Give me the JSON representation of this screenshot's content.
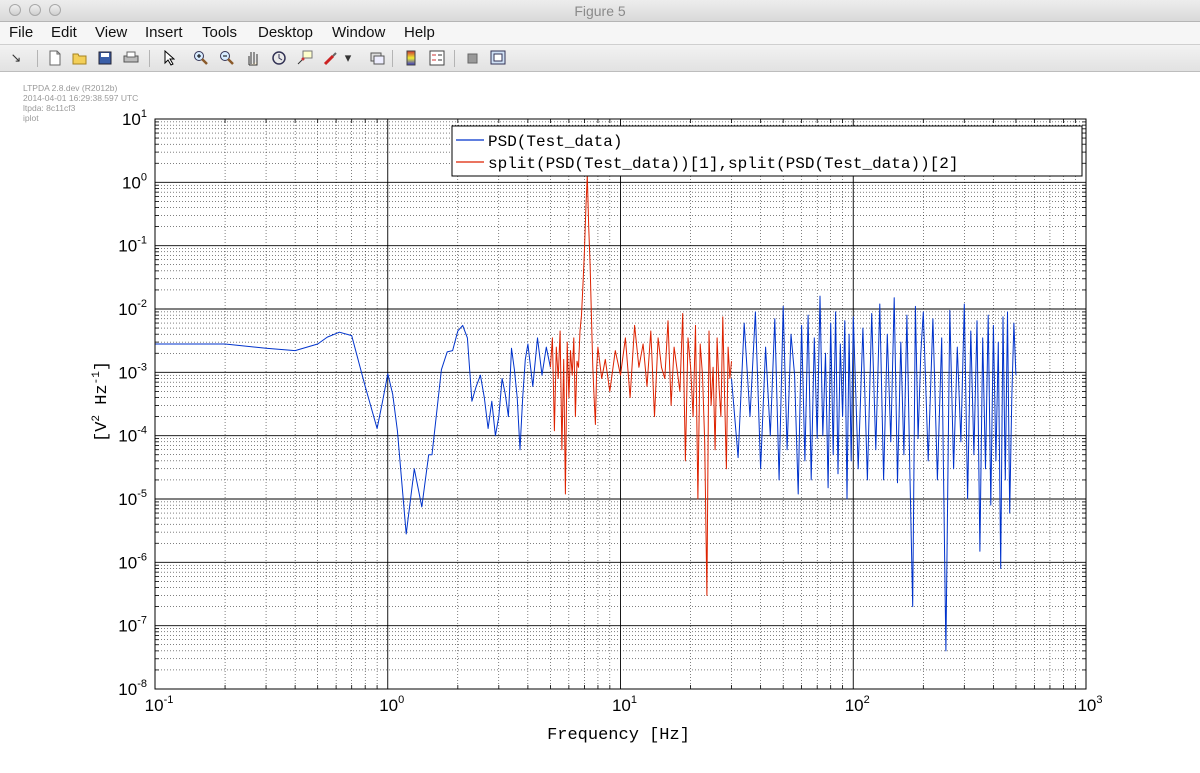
{
  "window": {
    "title": "Figure 5"
  },
  "menu": [
    "File",
    "Edit",
    "View",
    "Insert",
    "Tools",
    "Desktop",
    "Window",
    "Help"
  ],
  "toolbar_icons": [
    "dock-arrow-icon",
    "new-figure-icon",
    "open-file-icon",
    "save-icon",
    "print-icon",
    "pointer-icon",
    "zoom-in-icon",
    "zoom-out-icon",
    "pan-hand-icon",
    "rotate-3d-icon",
    "data-cursor-icon",
    "brush-icon",
    "brush-dropdown-icon",
    "link-plot-icon",
    "colorbar-icon",
    "legend-icon",
    "hide-plot-tools-icon",
    "show-plot-tools-icon"
  ],
  "meta": {
    "version": "LTPDA 2.8.dev (R2012b)",
    "timestamp": "2014-04-01 16:29:38.597 UTC",
    "hash": "ltpda: 8c11cf3",
    "function": "iplot"
  },
  "chart_data": {
    "type": "line",
    "xscale": "log",
    "yscale": "log",
    "xlim": [
      0.1,
      1000
    ],
    "ylim": [
      1e-08,
      10
    ],
    "xlabel": "Frequency  [Hz]",
    "ylabel_parts": {
      "base1": "[V",
      "exp1": "2",
      "mid": " Hz",
      "exp2": "-1",
      "end": "]"
    },
    "x_ticks": [
      {
        "base": "10",
        "exp": "-1"
      },
      {
        "base": "10",
        "exp": "0"
      },
      {
        "base": "10",
        "exp": "1"
      },
      {
        "base": "10",
        "exp": "2"
      },
      {
        "base": "10",
        "exp": "3"
      }
    ],
    "y_ticks": [
      {
        "base": "10",
        "exp": "1"
      },
      {
        "base": "10",
        "exp": "0"
      },
      {
        "base": "10",
        "exp": "-1"
      },
      {
        "base": "10",
        "exp": "-2"
      },
      {
        "base": "10",
        "exp": "-3"
      },
      {
        "base": "10",
        "exp": "-4"
      },
      {
        "base": "10",
        "exp": "-5"
      },
      {
        "base": "10",
        "exp": "-6"
      },
      {
        "base": "10",
        "exp": "-7"
      },
      {
        "base": "10",
        "exp": "-8"
      }
    ],
    "grid": true,
    "minor_grid": true,
    "legend_position": "top-right",
    "series": [
      {
        "name": "PSD(Test_data)",
        "color": "#0033cc",
        "segments": [
          {
            "x": [
              0.1,
              0.2,
              0.3,
              0.4,
              0.5,
              0.55,
              0.62,
              0.7,
              0.8,
              0.9,
              0.95,
              1.0,
              1.05,
              1.1,
              1.2,
              1.3,
              1.4,
              1.5,
              1.55,
              1.7,
              1.8,
              1.9,
              2.0,
              2.1,
              2.2,
              2.3,
              2.4,
              2.5,
              2.6,
              2.7,
              2.8,
              2.9,
              3.0,
              3.1,
              3.2,
              3.3,
              3.4,
              3.5,
              3.6,
              3.7,
              3.8,
              3.9,
              4.0,
              4.2,
              4.4,
              4.6,
              4.8,
              5.0
            ],
            "y": [
              0.0028,
              0.0028,
              0.0024,
              0.0022,
              0.0028,
              0.0036,
              0.0043,
              0.0038,
              0.0006,
              0.00013,
              0.00035,
              0.00095,
              0.00045,
              0.00012,
              2.8e-06,
              3e-05,
              7.5e-06,
              5e-05,
              5e-05,
              0.0011,
              0.0021,
              0.0022,
              0.0045,
              0.0055,
              0.0035,
              0.00035,
              0.0006,
              0.0009,
              0.0004,
              0.00013,
              0.00035,
              0.0001,
              0.0002,
              0.0008,
              0.00045,
              0.0002,
              0.0024,
              0.0011,
              0.0004,
              6e-05,
              0.0004,
              0.0016,
              0.0028,
              0.0006,
              0.0035,
              0.0009,
              0.0025,
              0.0012
            ]
          },
          {
            "x": [
              30,
              32,
              34,
              36,
              38,
              40,
              42,
              44,
              46,
              48,
              50,
              52,
              54,
              56,
              58,
              60,
              62,
              64,
              66,
              68,
              70,
              72,
              74,
              76,
              78,
              80,
              82,
              84,
              86,
              88,
              90,
              92,
              94,
              96,
              98,
              100,
              105,
              110,
              115,
              120,
              125,
              130,
              135,
              140,
              145,
              150,
              155,
              160,
              165,
              170,
              175,
              180,
              185,
              190,
              195,
              200,
              210,
              220,
              230,
              240,
              250,
              260,
              270,
              280,
              290,
              300,
              310,
              320,
              330,
              340,
              350,
              360,
              370,
              380,
              390,
              400,
              410,
              420,
              430,
              440,
              450,
              460,
              470,
              480,
              490,
              500
            ],
            "y": [
              0.0008,
              4.5e-05,
              0.006,
              0.0002,
              0.009,
              3e-05,
              0.0025,
              0.0001,
              0.007,
              2e-05,
              0.011,
              6e-05,
              0.004,
              0.0009,
              1.2e-05,
              0.0055,
              4e-05,
              0.008,
              2e-05,
              0.0035,
              9e-05,
              0.016,
              0.0001,
              0.002,
              1.5e-05,
              0.006,
              5e-05,
              0.009,
              2.5e-05,
              0.0028,
              0.0002,
              0.0065,
              1e-05,
              0.004,
              4e-05,
              0.0075,
              3e-05,
              0.005,
              2e-05,
              0.0085,
              6e-05,
              0.012,
              2e-05,
              0.004,
              8e-05,
              0.015,
              1.8e-05,
              0.003,
              5e-05,
              0.008,
              3e-05,
              2e-07,
              0.011,
              9e-05,
              0.002,
              0.009,
              4e-05,
              0.007,
              2e-05,
              0.0035,
              4e-08,
              0.0095,
              3e-05,
              0.0025,
              8e-05,
              0.012,
              1e-05,
              0.0045,
              5e-05,
              0.0065,
              1.5e-06,
              0.0035,
              3e-05,
              0.008,
              8e-06,
              0.0055,
              4e-05,
              0.003,
              8e-07,
              0.0075,
              2e-05,
              0.009,
              6e-06,
              0.0004,
              0.006,
              0.0009
            ]
          }
        ]
      },
      {
        "name": "split(PSD(Test_data))[1],split(PSD(Test_data))[2]",
        "color": "#dd2200",
        "segments": [
          {
            "x": [
              5.0,
              5.1,
              5.2,
              5.3,
              5.4,
              5.5,
              5.6,
              5.7,
              5.8,
              5.9,
              6.0,
              6.1,
              6.2,
              6.3,
              6.4,
              6.5,
              6.6,
              6.7,
              6.8,
              6.9,
              7.0,
              7.1,
              7.2,
              7.3,
              7.4,
              7.5,
              7.6,
              7.7,
              7.8,
              7.9,
              8.0,
              8.3,
              8.6,
              9.0,
              9.5,
              10.0,
              10.5,
              11.0,
              11.5,
              12.0,
              12.5,
              13.0,
              13.5,
              14.0,
              14.5,
              15.0,
              15.5,
              16.0,
              16.5,
              17.0,
              17.5,
              18.0,
              18.5,
              19.0,
              19.5,
              20.0,
              20.5,
              21.0,
              21.5,
              22.0,
              22.5,
              23.0,
              23.5,
              24.0,
              24.5,
              25.0,
              25.5,
              26.0,
              26.5,
              27.0,
              27.5,
              28.0,
              28.5,
              29.0,
              29.5,
              30.0
            ],
            "y": [
              0.0012,
              0.0035,
              0.00012,
              0.0025,
              0.0008,
              0.0045,
              6e-05,
              0.0016,
              1.2e-05,
              0.003,
              0.0004,
              0.0022,
              0.0009,
              0.0035,
              0.0002,
              0.0015,
              0.0012,
              0.0045,
              0.008,
              0.025,
              0.08,
              0.4,
              1.3,
              0.2,
              0.05,
              0.008,
              0.0012,
              0.0004,
              0.00015,
              0.0012,
              0.0025,
              0.0008,
              0.0016,
              0.0005,
              0.0022,
              0.0009,
              0.0035,
              0.0004,
              0.0055,
              0.0012,
              0.0028,
              0.0006,
              0.0045,
              0.0002,
              0.0035,
              0.0012,
              0.0008,
              0.0065,
              0.0003,
              0.0025,
              0.0011,
              0.0005,
              0.0085,
              4e-05,
              0.0035,
              0.0012,
              0.0002,
              0.0055,
              1e-05,
              0.0028,
              0.0009,
              8e-05,
              3e-07,
              0.0045,
              0.0003,
              0.0012,
              6e-05,
              0.0035,
              0.0006,
              0.0002,
              0.0075,
              0.0004,
              3e-05,
              0.0025,
              0.0008,
              0.0015
            ]
          }
        ]
      }
    ]
  }
}
